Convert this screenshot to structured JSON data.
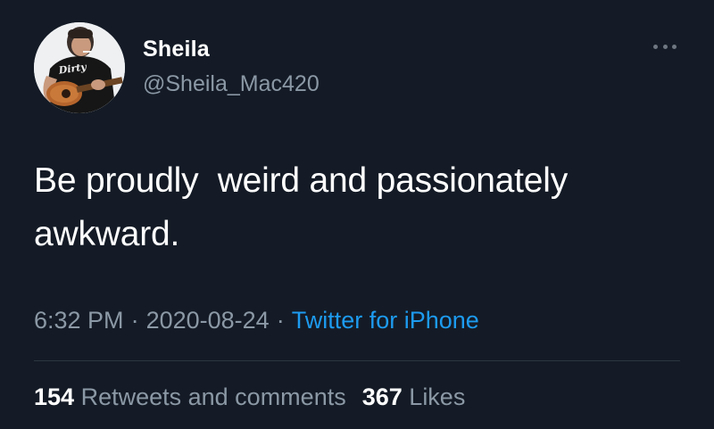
{
  "tweet": {
    "author": {
      "display_name": "Sheila",
      "handle": "@Sheila_Mac420",
      "avatar_shirt_text": "Dirty"
    },
    "more_icon": "more-dots-icon",
    "text": "Be proudly  weird and passionately\nawkward.",
    "meta": {
      "time": "6:32 PM",
      "separator": "·",
      "date": "2020-08-24",
      "source": "Twitter for iPhone"
    },
    "stats": {
      "retweets_count": "154",
      "retweets_label": "Retweets and comments",
      "likes_count": "367",
      "likes_label": "Likes"
    }
  },
  "colors": {
    "background": "#141b26",
    "text": "#ffffff",
    "secondary": "#8b98a5",
    "link": "#1d9bf0",
    "divider": "#2b3641"
  }
}
